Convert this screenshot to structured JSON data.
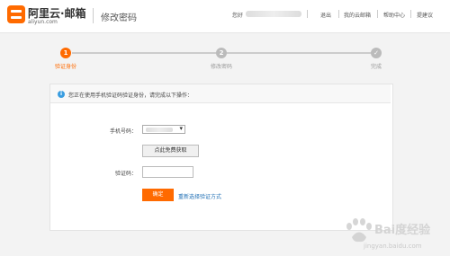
{
  "header": {
    "logo_text": "阿里云·邮箱",
    "logo_sub": "aliyun.com",
    "page_title": "修改密码",
    "greeting": "您好",
    "nav": [
      "退出",
      "我的云邮箱",
      "帮助中心",
      "提建议"
    ]
  },
  "steps": [
    {
      "number": "1",
      "label": "验证身份",
      "state": "active"
    },
    {
      "number": "2",
      "label": "修改密码",
      "state": "pending"
    },
    {
      "number": "✓",
      "label": "完成",
      "state": "pending"
    }
  ],
  "notice": {
    "icon": "i",
    "text": "您正在使用手机验证码验证身份，请完成以下操作："
  },
  "form": {
    "phone_label": "手机号码：",
    "get_code_label": "点此免费获取",
    "code_label": "验证码：",
    "code_value": "",
    "confirm_label": "确定",
    "alt_link": "重新选择验证方式"
  },
  "watermark": {
    "brand": "Bai度经验",
    "url": "jingyan.baidu.com"
  },
  "colors": {
    "accent": "#ff6a00",
    "link": "#1f6fb5",
    "info": "#3a9de0"
  }
}
